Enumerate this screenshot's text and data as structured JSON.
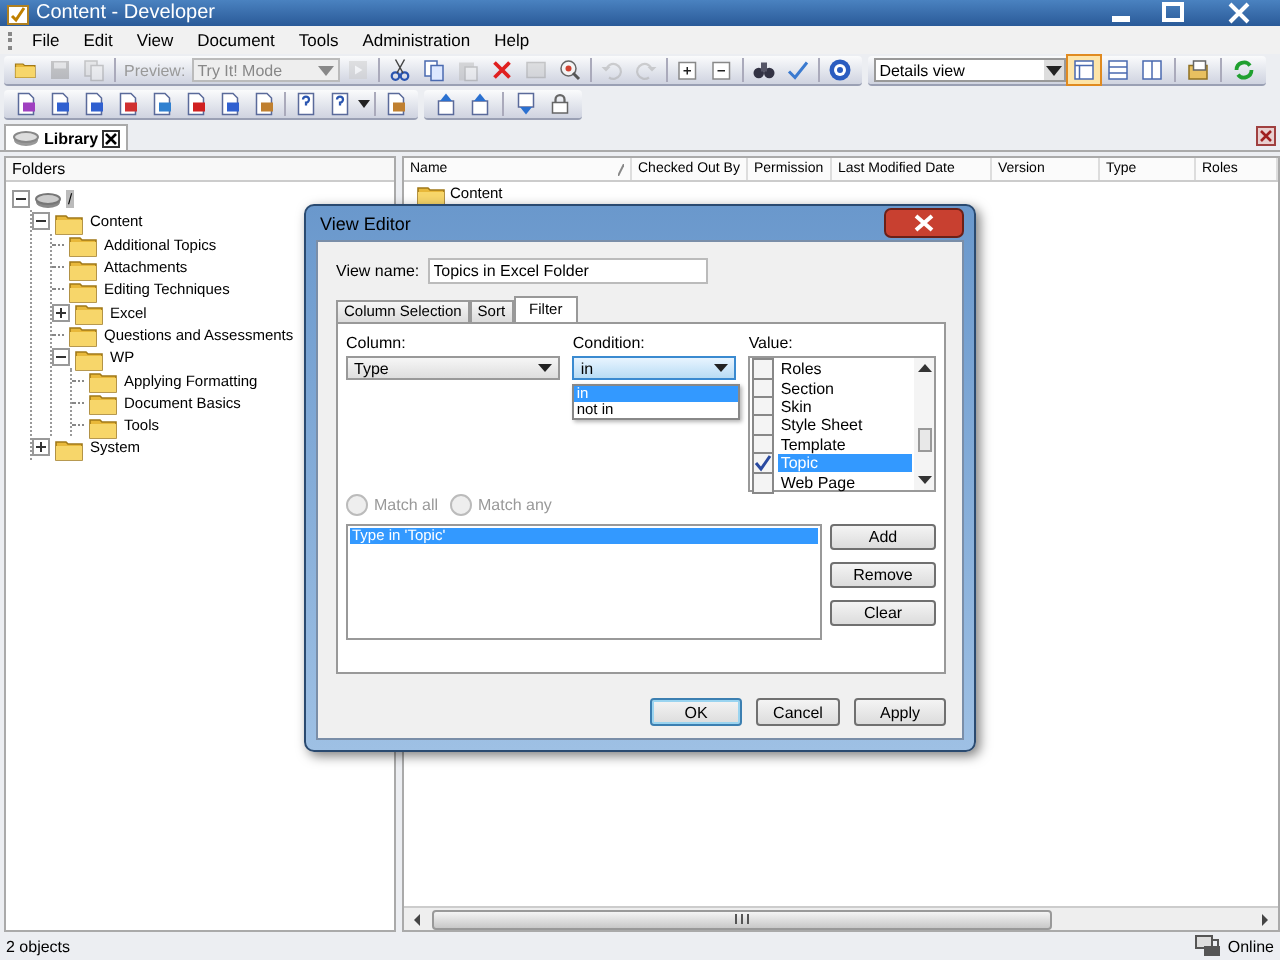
{
  "window": {
    "title": "Content - Developer"
  },
  "menu": [
    "File",
    "Edit",
    "View",
    "Document",
    "Tools",
    "Administration",
    "Help"
  ],
  "toolbar": {
    "preview_label": "Preview:",
    "mode_dropdown": {
      "value": "Try It! Mode",
      "disabled": true
    },
    "view_dropdown": {
      "value": "Details view"
    },
    "view_buttons": [
      {
        "selected": true
      },
      {
        "selected": false
      },
      {
        "selected": false
      }
    ]
  },
  "tabs": [
    {
      "label": "Library",
      "selected": true
    }
  ],
  "folders": {
    "heading": "Folders",
    "tree": [
      {
        "label": "/",
        "kind": "root",
        "expanded": true,
        "selected": true,
        "children": [
          {
            "label": "Content",
            "expanded": true,
            "children": [
              {
                "label": "Additional Topics"
              },
              {
                "label": "Attachments"
              },
              {
                "label": "Editing Techniques"
              },
              {
                "label": "Excel",
                "expanded": false
              },
              {
                "label": "Questions and Assessments"
              },
              {
                "label": "WP",
                "expanded": true,
                "children": [
                  {
                    "label": "Applying Formatting"
                  },
                  {
                    "label": "Document Basics"
                  },
                  {
                    "label": "Tools"
                  }
                ]
              }
            ]
          },
          {
            "label": "System",
            "expanded": false
          }
        ]
      }
    ]
  },
  "table": {
    "columns": [
      "Name",
      "Checked Out By",
      "Permission",
      "Last Modified Date",
      "Version",
      "Type",
      "Roles"
    ],
    "rows": [
      {
        "name": "Content"
      }
    ]
  },
  "dialog": {
    "title": "View Editor",
    "view_name_label": "View name:",
    "view_name": "Topics in Excel Folder",
    "tabs": [
      {
        "label": "Column Selection",
        "selected": false
      },
      {
        "label": "Sort",
        "selected": false
      },
      {
        "label": "Filter",
        "selected": true
      }
    ],
    "column_label": "Column:",
    "column_value": "Type",
    "condition_label": "Condition:",
    "condition_value": "in",
    "condition_options": [
      {
        "label": "in",
        "selected": true
      },
      {
        "label": "not in",
        "selected": false
      }
    ],
    "value_label": "Value:",
    "values": [
      {
        "label": "Roles",
        "checked": false,
        "selected": false
      },
      {
        "label": "Section",
        "checked": false,
        "selected": false
      },
      {
        "label": "Skin",
        "checked": false,
        "selected": false
      },
      {
        "label": "Style Sheet",
        "checked": false,
        "selected": false
      },
      {
        "label": "Template",
        "checked": false,
        "selected": false
      },
      {
        "label": "Topic",
        "checked": true,
        "selected": true
      },
      {
        "label": "Web Page",
        "checked": false,
        "selected": false
      }
    ],
    "match": [
      {
        "label": "Match all",
        "selected": false,
        "disabled": true
      },
      {
        "label": "Match any",
        "selected": false,
        "disabled": true
      }
    ],
    "filters": [
      {
        "label": "Type in 'Topic'",
        "selected": true
      }
    ],
    "side_buttons": [
      "Add",
      "Remove",
      "Clear"
    ],
    "buttons": [
      {
        "label": "OK",
        "default": true
      },
      {
        "label": "Cancel",
        "default": false
      },
      {
        "label": "Apply",
        "default": false
      }
    ]
  },
  "status_bar": {
    "count": "2 objects",
    "connection": "Online"
  }
}
